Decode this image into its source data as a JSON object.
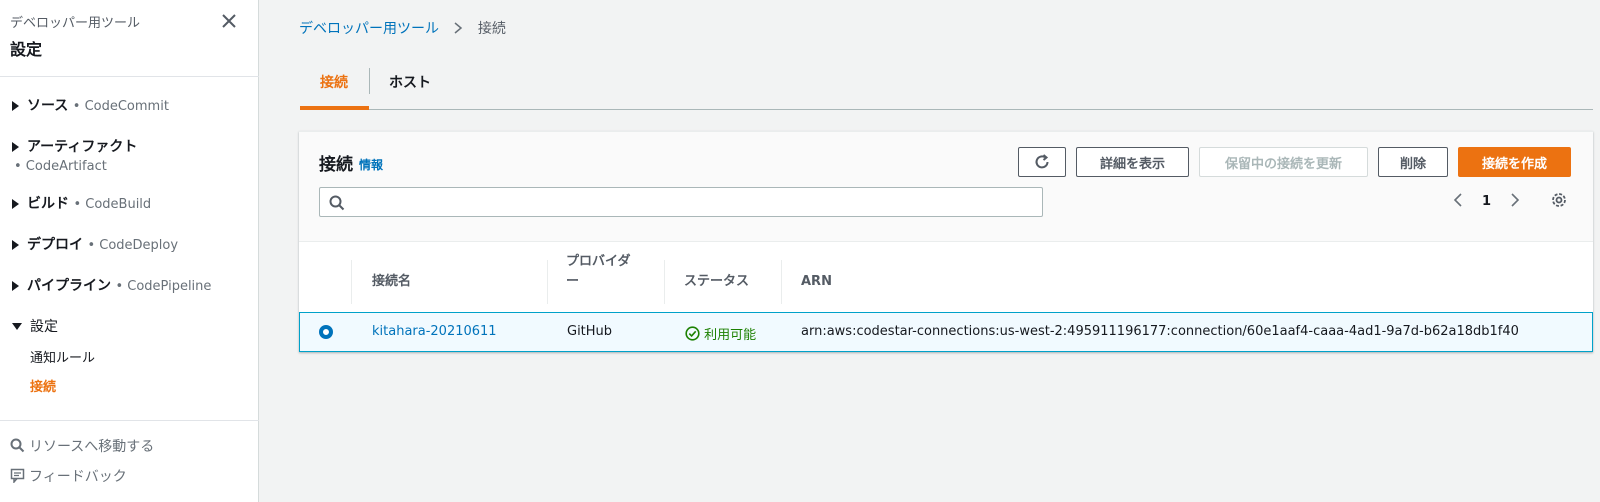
{
  "sidebar": {
    "service": "デベロッパー用ツール",
    "title": "設定",
    "sections": [
      {
        "name": "ソース",
        "svc": "• CodeCommit"
      },
      {
        "name": "アーティファクト",
        "svc": "• CodeArtifact"
      },
      {
        "name": "ビルド",
        "svc": "• CodeBuild"
      },
      {
        "name": "デプロイ",
        "svc": "• CodeDeploy"
      },
      {
        "name": "パイプライン",
        "svc": "• CodePipeline"
      },
      {
        "name": "設定",
        "svc": ""
      }
    ],
    "sub_items": [
      "通知ルール",
      "接続"
    ],
    "footer": {
      "goto": "リソースへ移動する",
      "feedback": "フィードバック"
    }
  },
  "breadcrumb": {
    "parent": "デベロッパー用ツール",
    "current": "接続"
  },
  "tabs": [
    "接続",
    "ホスト"
  ],
  "panel": {
    "title": "接続",
    "info": "情報",
    "buttons": {
      "details": "詳細を表示",
      "update_pending": "保留中の接続を更新",
      "delete": "削除",
      "create": "接続を作成"
    },
    "search_placeholder": "",
    "page": "1",
    "columns": {
      "name": "接続名",
      "provider_line1": "プロバイダ",
      "provider_line2": "ー",
      "status": "ステータス",
      "arn": "ARN"
    },
    "rows": [
      {
        "name": "kitahara-20210611",
        "provider": "GitHub",
        "status": "利用可能",
        "arn": "arn:aws:codestar-connections:us-west-2:495911196177:connection/60e1aaf4-caaa-4ad1-9a7d-b62a18db1f40"
      }
    ]
  },
  "colors": {
    "accent": "#ec7211",
    "link": "#0073bb",
    "ok": "#1d8102"
  }
}
